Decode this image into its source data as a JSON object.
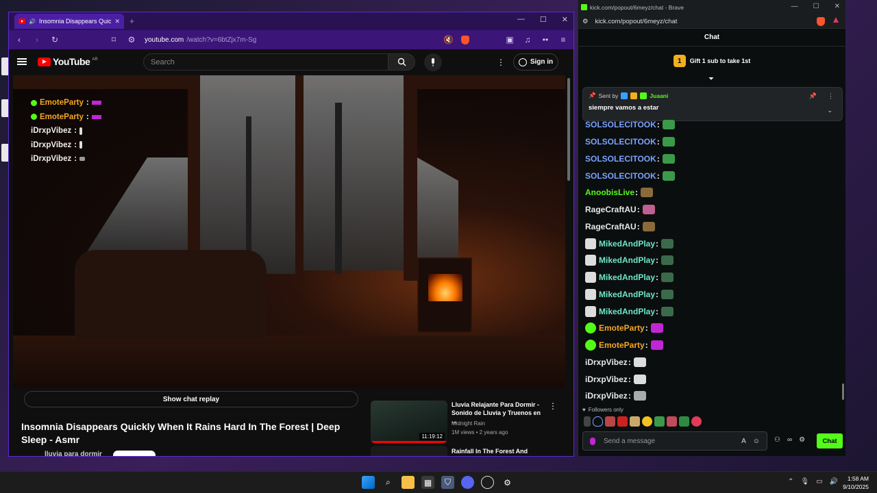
{
  "colors": {
    "accent_purple": "#5b2bd6",
    "kick_green": "#53fc18",
    "yt_red": "#ff0000"
  },
  "left_browser": {
    "tab_title": "Insomnia Disappears Quickly",
    "tab_icon": "youtube-icon",
    "url_main": "youtube.com",
    "url_rest": "/watch?v=6btZjx7m-Sg",
    "youtube": {
      "logo_text": "YouTube",
      "region": "AR",
      "search_placeholder": "Search",
      "signin_label": "Sign in",
      "show_chat_replay": "Show chat replay",
      "video_title": "Insomnia Disappears Quickly When It Rains Hard In The Forest | Deep Sleep - Asmr",
      "channel_name": "lluvia para dormir",
      "overlay_chat": [
        {
          "name": "EmoteParty",
          "verified": true,
          "color": "orange"
        },
        {
          "name": "EmoteParty",
          "verified": true,
          "color": "orange"
        },
        {
          "name": "iDrxpVibez",
          "verified": false,
          "color": "white"
        },
        {
          "name": "iDrxpVibez",
          "verified": false,
          "color": "white"
        },
        {
          "name": "iDrxpVibez",
          "verified": false,
          "color": "white"
        }
      ],
      "recommendations": [
        {
          "title": "Lluvia Relajante Para Dormir - Sonido de Lluvia y Truenos en ...",
          "channel": "Midnight Rain",
          "meta": "1M views • 2 years ago",
          "duration": "11:19:12"
        },
        {
          "title": "Rainfall In The Forest And"
        }
      ]
    }
  },
  "right_browser": {
    "window_title": "kick.com/popout/6meyz/chat - Brave",
    "url": "kick.com/popout/6meyz/chat",
    "chat_title": "Chat",
    "gift_badge": "1",
    "gift_text": "Gift 1 sub to take 1st",
    "pinned": {
      "sent_by_label": "Sent by",
      "user": "Juaani",
      "message": "siempre vamos a estar"
    },
    "messages": [
      {
        "user": "SOLSOLECITOOK",
        "color": "blue",
        "emote": "#3a9a4a"
      },
      {
        "user": "SOLSOLECITOOK",
        "color": "blue",
        "emote": "#3a9a4a"
      },
      {
        "user": "SOLSOLECITOOK",
        "color": "blue",
        "emote": "#3a9a4a"
      },
      {
        "user": "SOLSOLECITOOK",
        "color": "blue",
        "emote": "#3a9a4a"
      },
      {
        "user": "AnoobisLive",
        "color": "green",
        "emote": "#8a6a3a"
      },
      {
        "user": "RageCraftAU",
        "color": "white",
        "emote": "#c06090"
      },
      {
        "user": "RageCraftAU",
        "color": "white",
        "emote": "#8a6a3a"
      },
      {
        "user": "MikedAndPlay",
        "color": "teal",
        "badge": true,
        "emote": "#3a6a4a"
      },
      {
        "user": "MikedAndPlay",
        "color": "teal",
        "badge": true,
        "emote": "#3a6a4a"
      },
      {
        "user": "MikedAndPlay",
        "color": "teal",
        "badge": true,
        "emote": "#3a6a4a"
      },
      {
        "user": "MikedAndPlay",
        "color": "teal",
        "badge": true,
        "emote": "#3a6a4a"
      },
      {
        "user": "MikedAndPlay",
        "color": "teal",
        "badge": true,
        "emote": "#3a6a4a"
      },
      {
        "user": "EmoteParty",
        "color": "orange",
        "verified": true,
        "emote": "#c026d3"
      },
      {
        "user": "EmoteParty",
        "color": "orange",
        "verified": true,
        "emote": "#c026d3"
      },
      {
        "user": "iDrxpVibez",
        "color": "white",
        "emote": "#dddddd"
      },
      {
        "user": "iDrxpVibez",
        "color": "white",
        "emote": "#dddddd"
      },
      {
        "user": "iDrxpVibez",
        "color": "white",
        "emote": "#aaaaaa"
      }
    ],
    "followers_only": "Followers only",
    "input_placeholder": "Send a message",
    "send_label": "Chat"
  },
  "taskbar": {
    "time": "1:58 AM",
    "date": "9/10/2025"
  }
}
